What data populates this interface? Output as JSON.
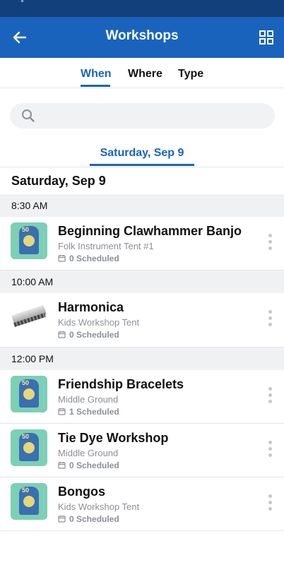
{
  "app": {
    "title": "Workshops"
  },
  "tabs": [
    {
      "label": "When",
      "active": true
    },
    {
      "label": "Where",
      "active": false
    },
    {
      "label": "Type",
      "active": false
    }
  ],
  "search": {
    "placeholder": ""
  },
  "date_tab": {
    "label": "Saturday, Sep 9"
  },
  "day_heading": "Saturday, Sep 9",
  "colors": {
    "primary": "#1a63bd",
    "status_bar": "#12407a",
    "thumb_bg": "#7dcfb6",
    "muted_text": "#8b8f96"
  },
  "groups": [
    {
      "time": "8:30 AM",
      "items": [
        {
          "title": "Beginning Clawhammer Banjo",
          "location": "Folk Instrument Tent #1",
          "scheduled": "0 Scheduled",
          "thumb": "festival-poster"
        }
      ]
    },
    {
      "time": "10:00 AM",
      "items": [
        {
          "title": "Harmonica",
          "location": "Kids Workshop Tent",
          "scheduled": "0 Scheduled",
          "thumb": "harmonica"
        }
      ]
    },
    {
      "time": "12:00 PM",
      "items": [
        {
          "title": "Friendship Bracelets",
          "location": "Middle Ground",
          "scheduled": "1 Scheduled",
          "thumb": "festival-poster"
        },
        {
          "title": "Tie Dye Workshop",
          "location": "Middle Ground",
          "scheduled": "0 Scheduled",
          "thumb": "festival-poster"
        },
        {
          "title": "Bongos",
          "location": "Kids Workshop Tent",
          "scheduled": "0 Scheduled",
          "thumb": "festival-poster"
        }
      ]
    }
  ]
}
